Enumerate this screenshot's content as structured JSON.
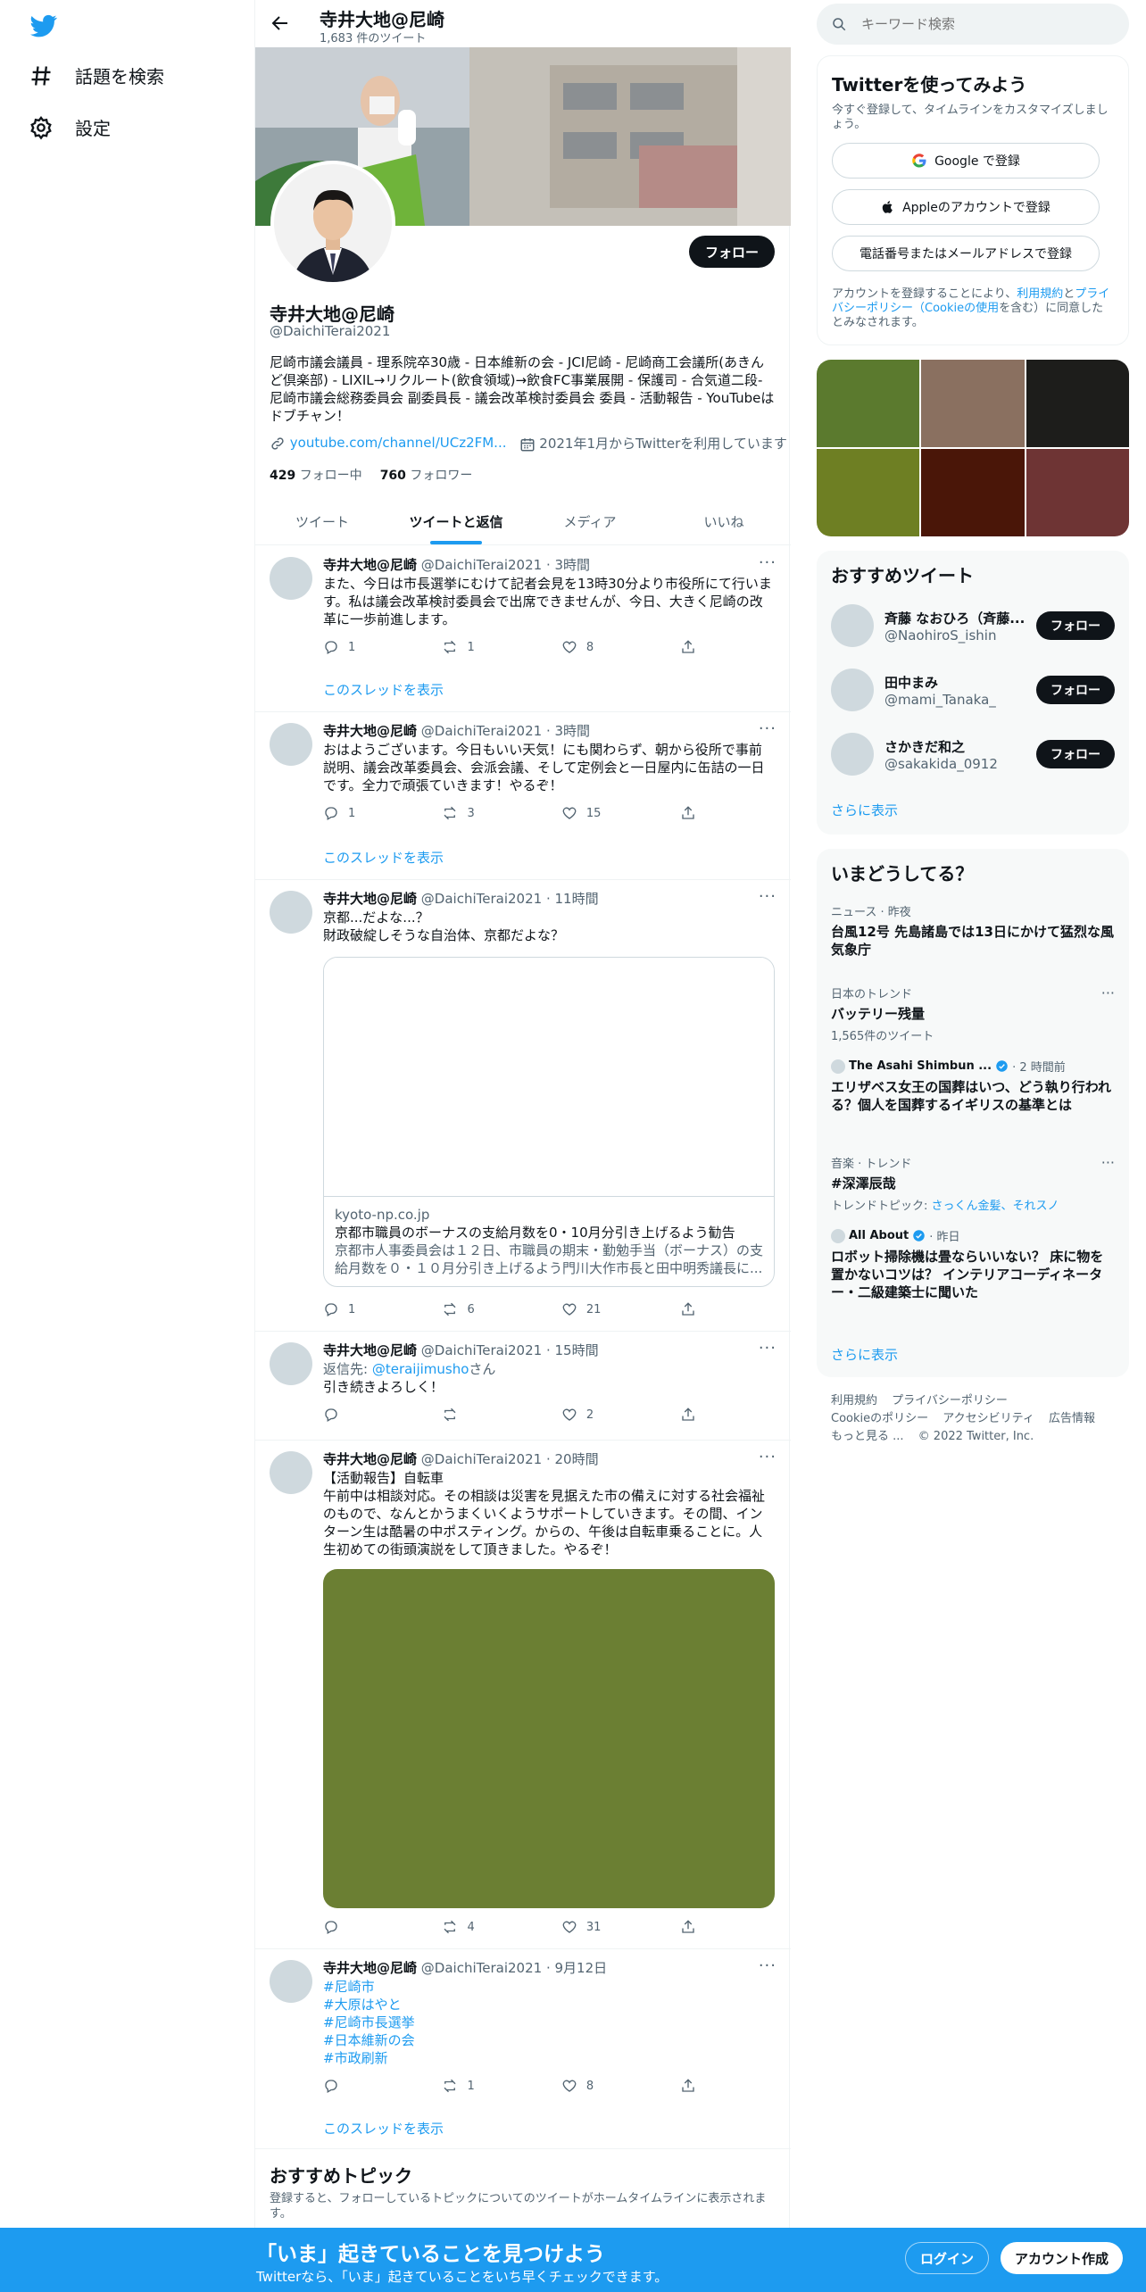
{
  "nav": {
    "logo": "twitter-bird-icon",
    "items": [
      {
        "label": "話題を検索",
        "icon": "hashtag-icon"
      },
      {
        "label": "設定",
        "icon": "gear-icon"
      }
    ]
  },
  "header": {
    "name": "寺井大地@尼崎",
    "tweet_count": "1,683 件のツイート"
  },
  "profile": {
    "follow_label": "フォロー",
    "name": "寺井大地@尼崎",
    "handle": "@DaichiTerai2021",
    "bio": "尼崎市議会議員 - 理系院卒30歳 - 日本維新の会 - JCI尼崎 - 尼崎商工会議所(あきんど倶楽部) - LIXIL→リクルート(飲食領域)→飲食FC事業展開 - 保護司 - 合気道二段- 尼崎市議会総務委員会 副委員長 - 議会改革検討委員会 委員 - 活動報告 - YouTubeはドブチャン！",
    "link": "youtube.com/channel/UCz2FM...",
    "joined": "2021年1月からTwitterを利用しています",
    "following_count": "429",
    "following_label": "フォロー中",
    "followers_count": "760",
    "followers_label": "フォロワー"
  },
  "tabs": [
    "ツイート",
    "ツイートと返信",
    "メディア",
    "いいね"
  ],
  "active_tab": 1,
  "tweets": [
    {
      "name": "寺井大地@尼崎",
      "handle": "@DaichiTerai2021",
      "time": "3時間",
      "text": "また、今日は市長選挙にむけて記者会見を13時30分より市役所にて行います。私は議会改革検討委員会で出席できませんが、今日、大きく尼崎の改革に一歩前進します。",
      "replies": "1",
      "retweets": "1",
      "likes": "8",
      "thread": "このスレッドを表示"
    },
    {
      "name": "寺井大地@尼崎",
      "handle": "@DaichiTerai2021",
      "time": "3時間",
      "text": "おはようございます。今日もいい天気！にも関わらず、朝から役所で事前説明、議会改革委員会、会派会議、そして定例会と一日屋内に缶詰の一日です。全力で頑張ていきます！やるぞ！",
      "replies": "1",
      "retweets": "3",
      "likes": "15",
      "thread": "このスレッドを表示"
    },
    {
      "name": "寺井大地@尼崎",
      "handle": "@DaichiTerai2021",
      "time": "11時間",
      "text_line1": "京都...だよな...？",
      "text_line2": "財政破綻しそうな自治体、京都だよな？",
      "card_domain": "kyoto-np.co.jp",
      "card_title": "京都市職員のボーナスの支給月数を0・10月分引き上げるよう勧告",
      "card_desc": "京都市人事委員会は１２日、市職員の期末・勤勉手当（ボーナス）の支給月数を０・１０月分引き上げるよう門川大作市長と田中明秀議長に...",
      "replies": "1",
      "retweets": "6",
      "likes": "21"
    },
    {
      "name": "寺井大地@尼崎",
      "handle": "@DaichiTerai2021",
      "time": "15時間",
      "reply_prefix": "返信先: ",
      "reply_to": "@teraijimusho",
      "reply_suffix": "さん",
      "text": "引き続きよろしく！",
      "replies": "",
      "retweets": "",
      "likes": "2"
    },
    {
      "name": "寺井大地@尼崎",
      "handle": "@DaichiTerai2021",
      "time": "20時間",
      "text": "【活動報告】自転車\n午前中は相談対応。その相談は災害を見据えた市の備えに対する社会福祉のもので、なんとかうまくいくようサポートしていきます。その間、インターン生は酷暑の中ポスティング。からの、午後は自転車乗ることに。人生初めての街頭演説をして頂きました。やるぞ！",
      "replies": "",
      "retweets": "4",
      "likes": "31"
    },
    {
      "name": "寺井大地@尼崎",
      "handle": "@DaichiTerai2021",
      "time": "9月12日",
      "hashtags": [
        "#尼崎市",
        "#大原はやと",
        "#尼崎市長選挙",
        "#日本維新の会",
        "#市政刷新"
      ],
      "replies": "",
      "retweets": "1",
      "likes": "8",
      "thread": "このスレッドを表示"
    }
  ],
  "reco_topics": {
    "title": "おすすめトピック",
    "desc": "登録すると、フォローしているトピックについてのツイートがホームタイムラインに表示されます。"
  },
  "search": {
    "placeholder": "キーワード検索"
  },
  "signup": {
    "title": "Twitterを使ってみよう",
    "sub": "今すぐ登録して、タイムラインをカスタマイズしましょう。",
    "google": "Google で登録",
    "apple": "Appleのアカウントで登録",
    "phone": "電話番号またはメールアドレスで登録",
    "terms_a": "アカウントを登録することにより、",
    "terms_link1": "利用規約",
    "terms_b": "と",
    "terms_link2": "プライバシーポリシー（Cookieの使用",
    "terms_c": "を含む）に同意したとみなされます。"
  },
  "media_colors": [
    "#5b7a2e",
    "#8a7060",
    "#1d1d1b",
    "#6e7f23",
    "#4a1608",
    "#6e3434"
  ],
  "reco_users": {
    "title": "おすすめツイート",
    "users": [
      {
        "name": "斉藤 なおひろ（斉藤...",
        "handle": "@NaohiroS_ishin"
      },
      {
        "name": "田中まみ",
        "handle": "@mami_Tanaka_"
      },
      {
        "name": "さかきだ和之",
        "handle": "@sakakida_0912"
      }
    ],
    "follow_label": "フォロー",
    "more": "さらに表示"
  },
  "trends": {
    "title": "いまどうしてる？",
    "items": [
      {
        "cat": "ニュース · 昨夜",
        "title": "台風12号 先島諸島では13日にかけて猛烈な風 気象庁"
      },
      {
        "cat": "日本のトレンド",
        "title": "バッテリー残量",
        "sub": "1,565件のツイート"
      },
      {
        "cat": "The Asahi Shimbun ...",
        "cat2": "· 2 時間前",
        "title": "エリザベス女王の国葬はいつ、どう執り行われる？個人を国葬するイギリスの基準とは"
      },
      {
        "cat": "音楽 · トレンド",
        "title": "#深澤辰哉",
        "sub_a": "トレンドトピック: ",
        "sub_b": "さっくん金髪、それスノ"
      },
      {
        "cat": "All About",
        "cat2": "· 昨日",
        "title": "ロボット掃除機は畳ならいいない？ 床に物を置かないコツは？ インテリアコーディネーター・二級建築士に聞いた"
      }
    ],
    "more": "さらに表示"
  },
  "footer": {
    "links": [
      "利用規約",
      "プライバシーポリシー",
      "Cookieのポリシー",
      "アクセシビリティ",
      "広告情報",
      "もっと見る ...",
      "© 2022 Twitter, Inc."
    ]
  },
  "bottom_bar": {
    "title": "「いま」起きていることを見つけよう",
    "sub": "Twitterなら、「いま」起きていることをいち早くチェックできます。",
    "login": "ログイン",
    "signup": "アカウント作成"
  },
  "colors": {
    "accent": "#1d9bf0",
    "text": "#0f1419",
    "muted": "#536471"
  }
}
